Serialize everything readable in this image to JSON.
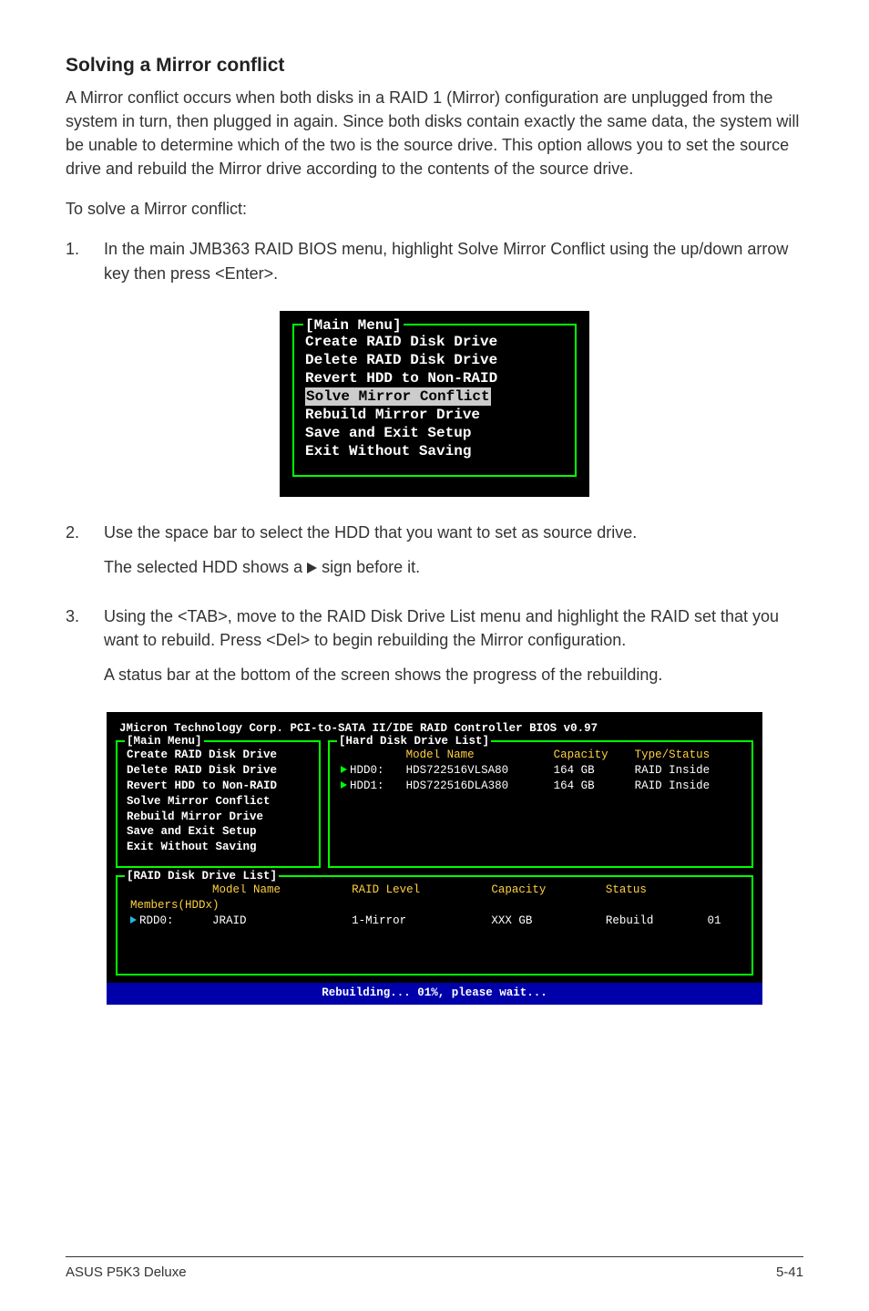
{
  "heading": "Solving a Mirror conflict",
  "intro": "A Mirror conflict occurs when both disks in a RAID 1 (Mirror) configuration are unplugged from the system in turn, then plugged in again. Since both disks contain exactly the same data, the system will be unable to determine which of the two is the source drive. This option allows you to set the source drive and rebuild the Mirror drive according to the contents of the source drive.",
  "lead": "To solve a Mirror conflict:",
  "steps": {
    "s1_num": "1.",
    "s1_text": "In the main JMB363 RAID BIOS menu, highlight Solve Mirror Conflict using the up/down arrow key then press <Enter>.",
    "s2_num": "2.",
    "s2_text_a": "Use the space bar to select the HDD that you want to set as source drive.",
    "s2_text_b_pre": "The selected HDD shows a ",
    "s2_text_b_post": " sign before it.",
    "s3_num": "3.",
    "s3_text": "Using the <TAB>, move to the RAID Disk Drive List menu and highlight the RAID set that you want to rebuild. Press <Del> to begin rebuilding the Mirror configuration.",
    "s3_note": "A status bar at the bottom of the screen shows the progress of the rebuilding."
  },
  "bios_small": {
    "title": "[Main Menu]",
    "items": [
      "Create RAID Disk Drive",
      "Delete RAID Disk Drive",
      "Revert HDD to Non-RAID",
      "Solve Mirror Conflict",
      "Rebuild Mirror Drive",
      "Save and Exit Setup",
      "Exit Without Saving"
    ],
    "highlight_index": 3
  },
  "bios_large": {
    "header": "JMicron Technology Corp. PCI-to-SATA II/IDE RAID Controller BIOS v0.97",
    "mainmenu_title": "[Main Menu]",
    "mainmenu_items": [
      "Create RAID Disk Drive",
      "Delete RAID Disk Drive",
      "Revert HDD to Non-RAID",
      "Solve Mirror Conflict",
      "Rebuild Mirror Drive",
      "Save and Exit Setup",
      "Exit Without Saving"
    ],
    "hddlist_title": "[Hard Disk Drive List]",
    "hdd_headers": {
      "model": "Model Name",
      "capacity": "Capacity",
      "type": "Type/Status"
    },
    "hdd_rows": [
      {
        "dev": "HDD0:",
        "model": "HDS722516VLSA80",
        "cap": "164 GB",
        "type": "RAID Inside"
      },
      {
        "dev": "HDD1:",
        "model": "HDS722516DLA380",
        "cap": "164 GB",
        "type": "RAID Inside"
      }
    ],
    "raidlist_title": "[RAID Disk Drive List]",
    "raid_headers": {
      "model": "Model Name",
      "level": "RAID Level",
      "cap": "Capacity",
      "status": "Status"
    },
    "raid_members_label": "Members(HDDx)",
    "raid_rows": [
      {
        "dev": "RDD0:",
        "model": "JRAID",
        "level": "1-Mirror",
        "cap": "XXX GB",
        "status": "Rebuild",
        "members": "01"
      }
    ],
    "status_bar": "Rebuilding... 01%, please wait..."
  },
  "footer": {
    "left": "ASUS P5K3 Deluxe",
    "right": "5-41"
  }
}
